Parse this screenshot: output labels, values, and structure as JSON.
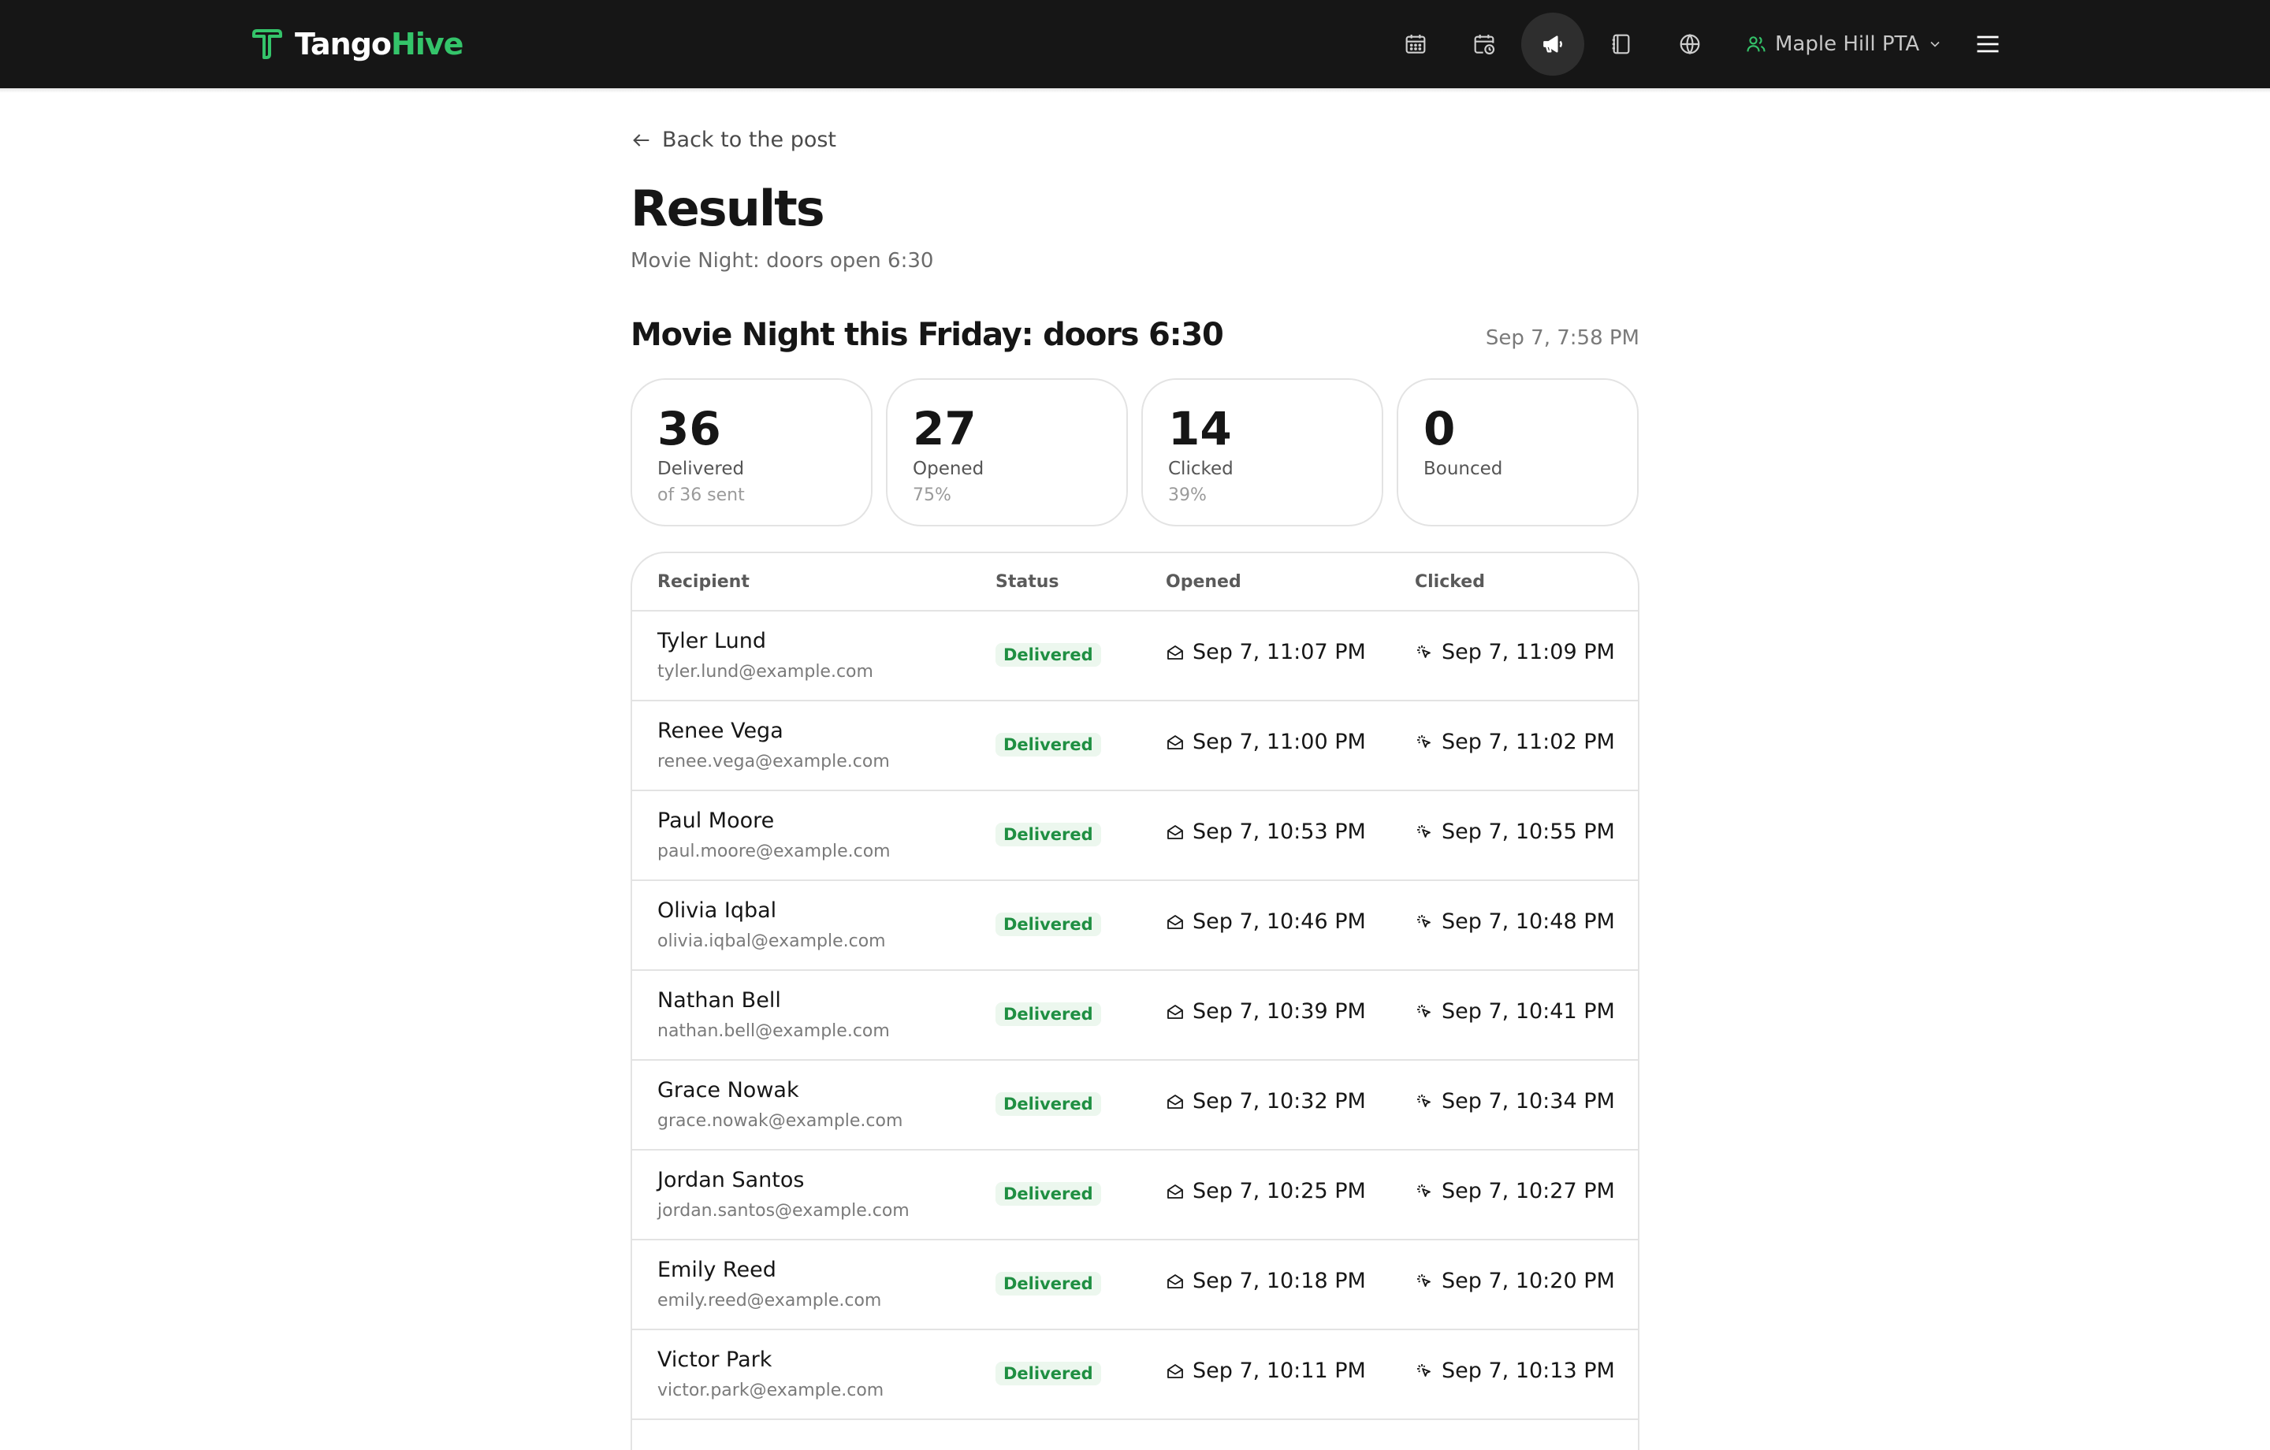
{
  "brand": {
    "part1": "Tango",
    "part2": "Hive"
  },
  "header": {
    "org_name": "Maple Hill PTA"
  },
  "nav": [
    {
      "icon": "calendar-icon"
    },
    {
      "icon": "calendar-clock-icon"
    },
    {
      "icon": "megaphone-icon",
      "active": true
    },
    {
      "icon": "book-icon"
    },
    {
      "icon": "globe-icon"
    }
  ],
  "page": {
    "back_label": "Back to the post",
    "title": "Results",
    "subtitle": "Movie Night: doors open 6:30"
  },
  "post": {
    "title": "Movie Night this Friday: doors 6:30",
    "sent_time": "Sep 7, 7:58 PM"
  },
  "stats": [
    {
      "value": "36",
      "label": "Delivered",
      "sub": "of 36 sent"
    },
    {
      "value": "27",
      "label": "Opened",
      "sub": "75%"
    },
    {
      "value": "14",
      "label": "Clicked",
      "sub": "39%"
    },
    {
      "value": "0",
      "label": "Bounced",
      "sub": ""
    }
  ],
  "table": {
    "headers": {
      "recipient": "Recipient",
      "status": "Status",
      "opened": "Opened",
      "clicked": "Clicked"
    },
    "rows": [
      {
        "name": "Tyler Lund",
        "email": "tyler.lund@example.com",
        "status": "Delivered",
        "opened": "Sep 7, 11:07 PM",
        "clicked": "Sep 7, 11:09 PM"
      },
      {
        "name": "Renee Vega",
        "email": "renee.vega@example.com",
        "status": "Delivered",
        "opened": "Sep 7, 11:00 PM",
        "clicked": "Sep 7, 11:02 PM"
      },
      {
        "name": "Paul Moore",
        "email": "paul.moore@example.com",
        "status": "Delivered",
        "opened": "Sep 7, 10:53 PM",
        "clicked": "Sep 7, 10:55 PM"
      },
      {
        "name": "Olivia Iqbal",
        "email": "olivia.iqbal@example.com",
        "status": "Delivered",
        "opened": "Sep 7, 10:46 PM",
        "clicked": "Sep 7, 10:48 PM"
      },
      {
        "name": "Nathan Bell",
        "email": "nathan.bell@example.com",
        "status": "Delivered",
        "opened": "Sep 7, 10:39 PM",
        "clicked": "Sep 7, 10:41 PM"
      },
      {
        "name": "Grace Nowak",
        "email": "grace.nowak@example.com",
        "status": "Delivered",
        "opened": "Sep 7, 10:32 PM",
        "clicked": "Sep 7, 10:34 PM"
      },
      {
        "name": "Jordan Santos",
        "email": "jordan.santos@example.com",
        "status": "Delivered",
        "opened": "Sep 7, 10:25 PM",
        "clicked": "Sep 7, 10:27 PM"
      },
      {
        "name": "Emily Reed",
        "email": "emily.reed@example.com",
        "status": "Delivered",
        "opened": "Sep 7, 10:18 PM",
        "clicked": "Sep 7, 10:20 PM"
      },
      {
        "name": "Victor Park",
        "email": "victor.park@example.com",
        "status": "Delivered",
        "opened": "Sep 7, 10:11 PM",
        "clicked": "Sep 7, 10:13 PM"
      }
    ]
  },
  "colors": {
    "header_bg": "#161616",
    "accent": "#34c46a",
    "badge_bg": "#ecf7ee",
    "badge_text": "#1f8f42"
  }
}
